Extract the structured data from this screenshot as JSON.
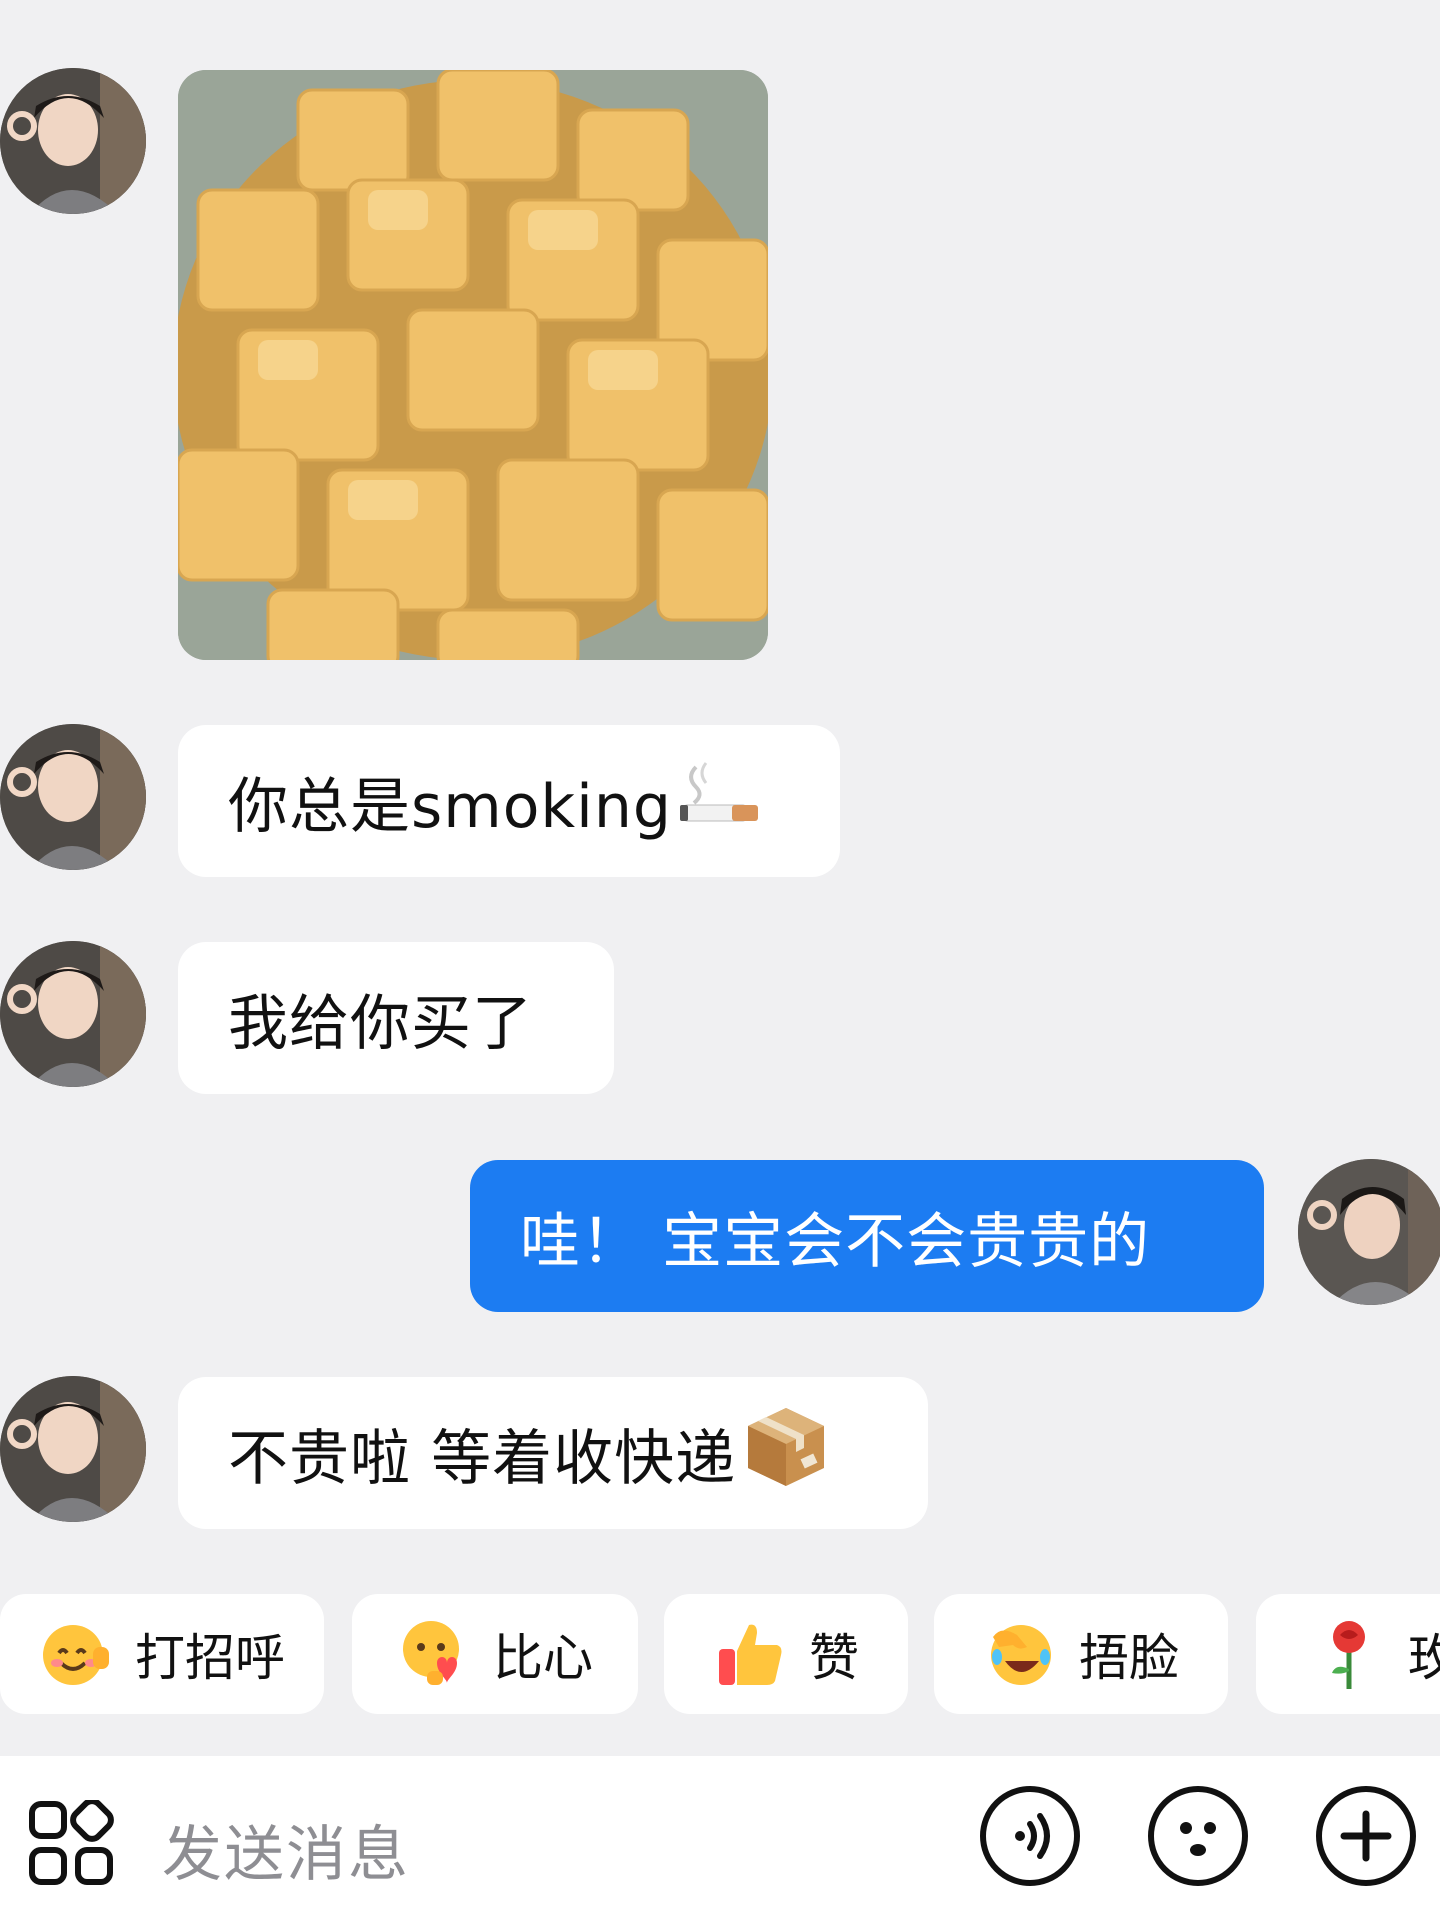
{
  "messages": [
    {
      "sender": "them",
      "kind": "image",
      "image_desc": "brown sugar cubes"
    },
    {
      "sender": "them",
      "kind": "text",
      "text": "你总是smoking",
      "emoji": "cigarette-emoji"
    },
    {
      "sender": "them",
      "kind": "text",
      "text": "我给你买了"
    },
    {
      "sender": "me",
      "kind": "text",
      "text": "哇！ 宝宝会不会贵贵的"
    },
    {
      "sender": "them",
      "kind": "text",
      "text": "不贵啦 等着收快递",
      "emoji": "package-emoji"
    }
  ],
  "quick_replies": [
    {
      "label": "打招呼",
      "icon": "waving-face-icon"
    },
    {
      "label": "比心",
      "icon": "heart-hands-face-icon"
    },
    {
      "label": "赞",
      "icon": "thumbs-up-icon"
    },
    {
      "label": "捂脸",
      "icon": "facepalm-laughing-icon"
    },
    {
      "label": "玫",
      "icon": "rose-icon"
    }
  ],
  "input": {
    "placeholder": "发送消息",
    "left_icon": "apps-grid-icon",
    "right_icons": [
      "voice-icon",
      "emoji-face-icon",
      "plus-icon"
    ]
  },
  "colors": {
    "background": "#f0f0f2",
    "my_bubble": "#1c7cf2",
    "their_bubble": "#ffffff"
  }
}
